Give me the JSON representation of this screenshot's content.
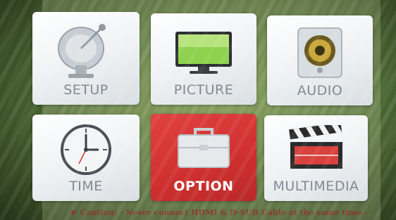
{
  "menu": {
    "items": [
      {
        "id": "setup",
        "label": "SETUP",
        "icon": "satellite-dish-icon"
      },
      {
        "id": "picture",
        "label": "PICTURE",
        "icon": "tv-monitor-icon"
      },
      {
        "id": "audio",
        "label": "AUDIO",
        "icon": "speaker-icon"
      },
      {
        "id": "time",
        "label": "TIME",
        "icon": "clock-icon"
      },
      {
        "id": "option",
        "label": "OPTION",
        "icon": "toolbox-icon",
        "selected": true
      },
      {
        "id": "multimedia",
        "label": "MULTIMEDIA",
        "icon": "clapperboard-icon"
      }
    ]
  },
  "background_text": {
    "caution": "Caution: - Never connect HDMI & D-SUB Cable at the same time.-"
  },
  "colors": {
    "selected_tile": "#d13533",
    "tile_label": "#808890"
  }
}
